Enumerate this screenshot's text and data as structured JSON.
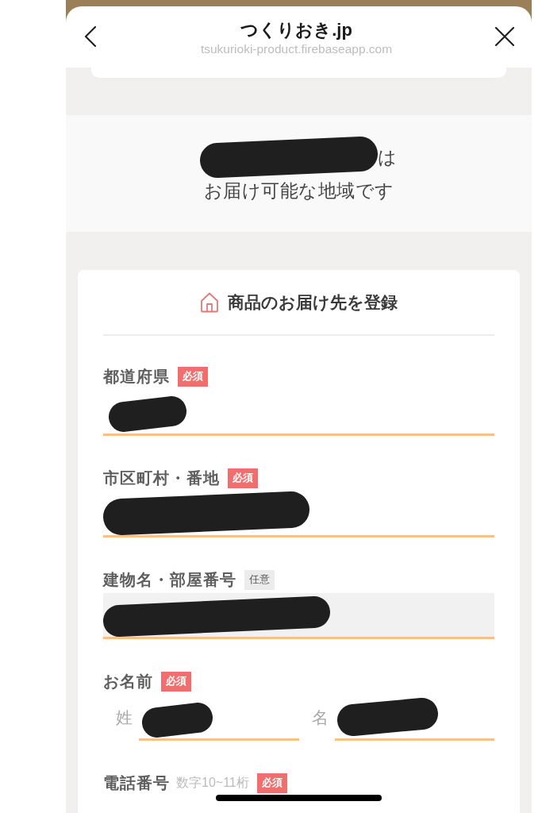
{
  "header": {
    "title": "つくりおき.jp",
    "url": "tsukurioki-product.firebaseapp.com"
  },
  "notice": {
    "lines": [
      {
        "redacted": true,
        "text": "は"
      },
      {
        "redacted": false,
        "text": "お届け可能な地域です"
      }
    ]
  },
  "form": {
    "title": "商品のお届け先を登録",
    "fields": [
      {
        "kind": "text",
        "label": "都道府県",
        "badge": {
          "kind": "required",
          "text": "必須"
        },
        "value_redacted": true,
        "highlighted": false
      },
      {
        "kind": "text",
        "label": "市区町村・番地",
        "badge": {
          "kind": "required",
          "text": "必須"
        },
        "value_redacted": true,
        "highlighted": false
      },
      {
        "kind": "text",
        "label": "建物名・部屋番号",
        "badge": {
          "kind": "optional",
          "text": "任意"
        },
        "value_redacted": true,
        "highlighted": true
      },
      {
        "kind": "name",
        "label": "お名前",
        "badge": {
          "kind": "required",
          "text": "必須"
        },
        "parts": [
          {
            "label": "姓",
            "value_redacted": true
          },
          {
            "label": "名",
            "value_redacted": true
          }
        ]
      },
      {
        "kind": "partial",
        "label": "電話番号",
        "hint": "数字10~11桁",
        "badge": {
          "kind": "required",
          "text": "必須"
        }
      }
    ]
  }
}
